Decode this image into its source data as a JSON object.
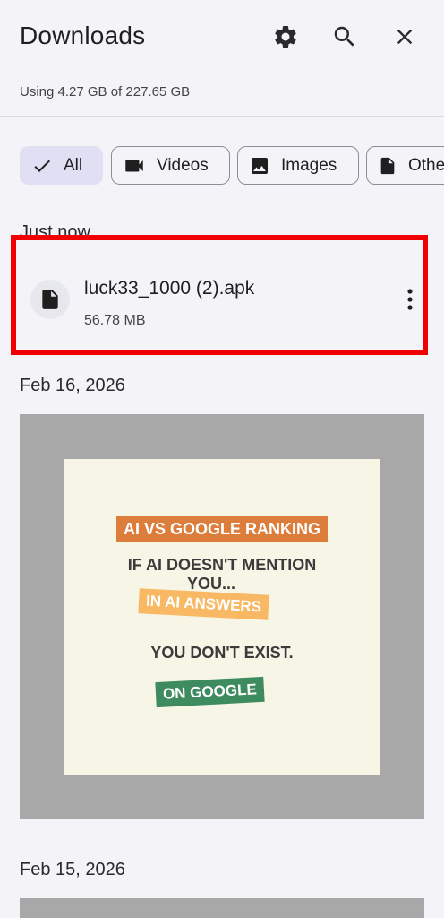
{
  "header": {
    "title": "Downloads",
    "icons": [
      "settings-gear-icon",
      "search-icon",
      "close-icon"
    ]
  },
  "storage": {
    "text": "Using 4.27 GB of 227.65 GB"
  },
  "filters": [
    {
      "label": "All",
      "icon": "check-icon",
      "selected": true
    },
    {
      "label": "Videos",
      "icon": "video-icon",
      "selected": false
    },
    {
      "label": "Images",
      "icon": "image-icon",
      "selected": false
    },
    {
      "label": "Othe",
      "icon": "document-icon",
      "selected": false
    }
  ],
  "sections": [
    {
      "label": "Just now",
      "items": [
        {
          "name": "luck33_1000 (2).apk",
          "size": "56.78 MB",
          "icon": "file-icon"
        }
      ]
    },
    {
      "label": "Feb 16, 2026",
      "image": {
        "lines": [
          "AI VS GOOGLE RANKING",
          "IF AI DOESN'T MENTION",
          "YOU...",
          "IN AI ANSWERS",
          "YOU DON'T EXIST.",
          "ON GOOGLE"
        ]
      }
    },
    {
      "label": "Feb 15, 2026"
    }
  ],
  "colors": {
    "background": "#f3f3f8",
    "chip_selected": "#e1dff4",
    "highlight": "#f00000",
    "tag_orange": "#dd7d3c",
    "tag_yellow": "#f9b864",
    "tag_green": "#3d8b5f"
  }
}
